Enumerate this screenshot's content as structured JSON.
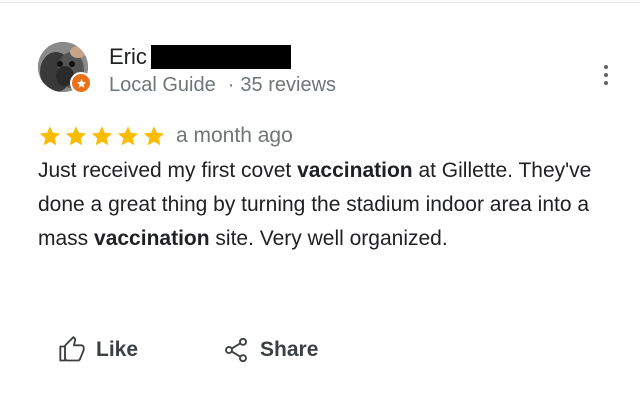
{
  "review": {
    "author_name": "Eric",
    "author_type": "Local Guide",
    "separator": "·",
    "review_count": "35 reviews",
    "rating": 5,
    "max_rating": 5,
    "date": "a month ago",
    "text_parts": [
      {
        "text": "Just received my first covet ",
        "bold": false
      },
      {
        "text": "vaccination",
        "bold": true
      },
      {
        "text": " at Gillette. They've done a great thing by turning the stadium indoor area into a mass ",
        "bold": false
      },
      {
        "text": "vaccination",
        "bold": true
      },
      {
        "text": " site. Very well organized.",
        "bold": false
      }
    ]
  },
  "actions": {
    "like_label": "Like",
    "share_label": "Share"
  },
  "icons": {
    "more": "more-vert-icon",
    "like": "thumb-up-icon",
    "share": "share-icon",
    "guide_badge": "local-guide-star-icon",
    "star": "star-icon"
  },
  "colors": {
    "star": "#fbbc04",
    "guide_badge": "#e8711c",
    "meta_text": "#70757a",
    "body_text": "#202124"
  }
}
